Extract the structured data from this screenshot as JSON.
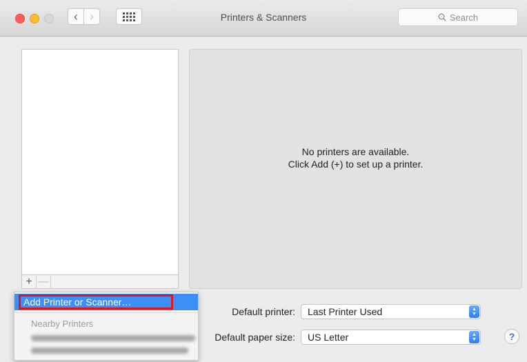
{
  "window": {
    "title": "Printers & Scanners"
  },
  "toolbar": {
    "back_glyph": "‹",
    "forward_glyph": "›",
    "search_placeholder": "Search"
  },
  "list": {
    "add_glyph": "+",
    "remove_glyph": "—"
  },
  "detail": {
    "empty_line1": "No printers are available.",
    "empty_line2": "Click Add (+) to set up a printer."
  },
  "settings": {
    "default_printer_label": "Default printer:",
    "default_printer_value": "Last Printer Used",
    "default_paper_label": "Default paper size:",
    "default_paper_value": "US Letter"
  },
  "add_menu": {
    "item": "Add Printer or Scanner…",
    "section_header": "Nearby Printers"
  },
  "help_glyph": "?",
  "colors": {
    "accent": "#3b8ff7",
    "highlight_border": "#e2141b",
    "close": "#fc5e57",
    "minimize": "#fdbc2e"
  },
  "icons": [
    "back-chevron-icon",
    "forward-chevron-icon",
    "grid-icon",
    "search-icon",
    "stepper-icon",
    "help-icon"
  ]
}
